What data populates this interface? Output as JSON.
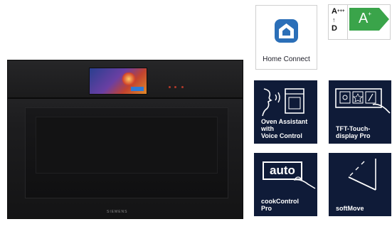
{
  "product": {
    "brand": "SIEMENS",
    "icon": "oven-product-image"
  },
  "features": [
    {
      "id": "home-connect",
      "label": "Home Connect",
      "icon": "home-connect-icon"
    },
    {
      "id": "energy-label",
      "scale_top": "A",
      "scale_top_sup": "+++",
      "scale_bottom": "D",
      "class": "A",
      "class_sup": "+",
      "badge_color": "#3aa44a",
      "icon": "energy-class-icon"
    },
    {
      "id": "oven-assistant",
      "label": "Oven Assistant\nwith\nVoice Control",
      "icon": "voice-control-icon"
    },
    {
      "id": "tft-touch",
      "label": "TFT-Touch-\ndisplay Pro",
      "icon": "touch-display-icon"
    },
    {
      "id": "cook-control",
      "label": "cookControl\nPro",
      "badge": "auto",
      "icon": "auto-hand-icon"
    },
    {
      "id": "soft-move",
      "label": "softMove",
      "icon": "soft-door-icon"
    }
  ],
  "colors": {
    "tile_bg": "#0f1b38",
    "home_connect_blue": "#2b6fb8"
  }
}
